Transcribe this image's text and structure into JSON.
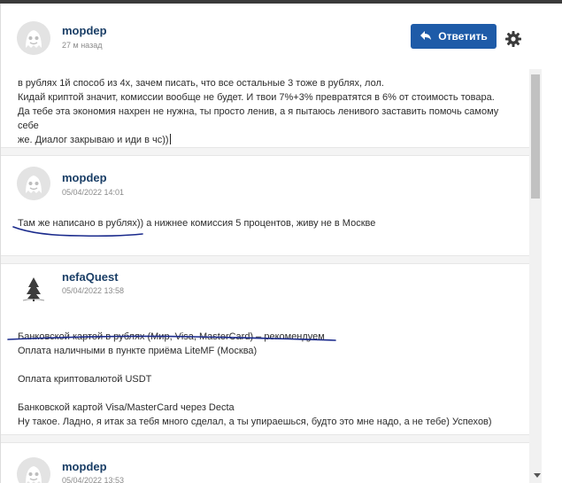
{
  "header": {
    "username": "mopdep",
    "time": "27 м назад",
    "reply_label": "Ответить"
  },
  "messages": [
    {
      "lines": [
        "в рублях 1й способ из 4х, зачем писать, что все остальные 3 тоже в рублях, лол.",
        "Кидай криптой значит, комиссии вообще не будет. И твои 7%+3% превратятся в 6% от стоимость товара.",
        "Да тебе эта экономия нахрен не нужна, ты просто ленив, а я пытаюсь ленивого заставить помочь самому себе",
        "же. Диалог закрываю и иди в чс))"
      ]
    },
    {
      "username": "mopdep",
      "time": "05/04/2022 14:01",
      "lines": [
        "Там же написано в рублях)) а нижнее комиссия 5 процентов, живу не в Москве"
      ]
    },
    {
      "username": "nefaQuest",
      "time": "05/04/2022 13:58",
      "lines": [
        "Банковской картой в рублях (Мир, Visa, MasterCard) – рекомендуем",
        "Оплата наличными в пункте приёма LiteMF (Москва)",
        "",
        "Оплата криптовалютой USDT",
        "",
        "Банковской картой Visa/MasterCard через Decta",
        "Ну такое. Ладно, я итак за тебя много сделал, а ты упираешься, будто это мне надо, а не тебе) Успехов)"
      ]
    },
    {
      "username": "mopdep",
      "time": "05/04/2022 13:53"
    }
  ],
  "colors": {
    "accent": "#1e5ba8",
    "username": "#1a3e66",
    "pen": "#1a2a8c"
  },
  "icons": {
    "reply": "reply-arrow-icon",
    "settings": "gear-icon",
    "avatar_default": "ghost-avatar-icon",
    "avatar_tree": "tree-avatar-icon"
  }
}
